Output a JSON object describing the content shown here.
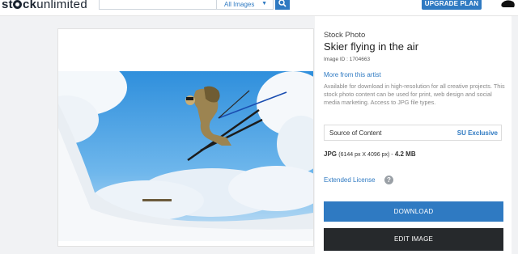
{
  "header": {
    "logo_part1": "st",
    "logo_part2": "ck",
    "logo_part3": "unlimited",
    "search_placeholder": "",
    "search_scope": "All Images",
    "upgrade_label": "UPGRADE PLAN"
  },
  "details": {
    "type": "Stock Photo",
    "title": "Skier flying in the air",
    "image_id": "Image ID : 1704663",
    "more_from_artist": "More from this artist",
    "description": "Available for download in high-resolution for all creative projects. This stock photo content can be used for print, web design and social media marketing. Access to JPG file types.",
    "source_label": "Source of Content",
    "source_value": "SU Exclusive",
    "format": "JPG",
    "dimensions": "(6144 px X 4096 px) -",
    "file_size": "4.2 MB",
    "license_label": "Extended License",
    "help": "?",
    "download_label": "DOWNLOAD",
    "edit_label": "EDIT IMAGE"
  },
  "colors": {
    "accent": "#2f7ac2",
    "dark_button": "#26292c",
    "page_bg": "#f1f2f4"
  }
}
